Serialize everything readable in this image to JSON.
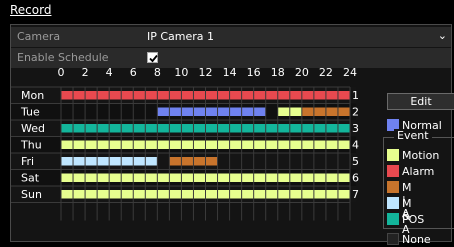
{
  "title": "Record",
  "camera": {
    "label": "Camera",
    "value": "IP Camera 1"
  },
  "schedule": {
    "label": "Enable Schedule",
    "checked": true
  },
  "hours": [
    "0",
    "2",
    "4",
    "6",
    "8",
    "10",
    "12",
    "14",
    "16",
    "18",
    "20",
    "22",
    "24"
  ],
  "days": [
    {
      "name": "Mon",
      "index": "1",
      "segments": [
        {
          "start": 0,
          "end": 24,
          "type": "alarm"
        }
      ]
    },
    {
      "name": "Tue",
      "index": "2",
      "segments": [
        {
          "start": 8,
          "end": 17,
          "type": "normal"
        },
        {
          "start": 18,
          "end": 20,
          "type": "motion"
        },
        {
          "start": 20,
          "end": 24,
          "type": "m_or_a"
        }
      ]
    },
    {
      "name": "Wed",
      "index": "3",
      "segments": [
        {
          "start": 0,
          "end": 24,
          "type": "pos"
        }
      ]
    },
    {
      "name": "Thu",
      "index": "4",
      "segments": [
        {
          "start": 0,
          "end": 24,
          "type": "motion"
        }
      ]
    },
    {
      "name": "Fri",
      "index": "5",
      "segments": [
        {
          "start": 0,
          "end": 8,
          "type": "m_and_a"
        },
        {
          "start": 9,
          "end": 13,
          "type": "m_or_a"
        }
      ]
    },
    {
      "name": "Sat",
      "index": "6",
      "segments": [
        {
          "start": 0,
          "end": 24,
          "type": "motion"
        }
      ]
    },
    {
      "name": "Sun",
      "index": "7",
      "segments": [
        {
          "start": 0,
          "end": 24,
          "type": "motion"
        }
      ]
    }
  ],
  "edit_label": "Edit",
  "legend": {
    "normal": {
      "label": "Normal",
      "color": "#6f82f0"
    },
    "event_title": "Event",
    "motion": {
      "label": "Motion",
      "color": "#e7ff8f"
    },
    "alarm": {
      "label": "Alarm",
      "color": "#e8494f"
    },
    "m_or_a": {
      "label": "M | A",
      "color": "#c8742c"
    },
    "m_and_a": {
      "label": "M & A",
      "color": "#bfe6ff"
    },
    "pos": {
      "label": "POS",
      "color": "#13b59b"
    },
    "none": {
      "label": "None",
      "color": "#222222"
    }
  }
}
